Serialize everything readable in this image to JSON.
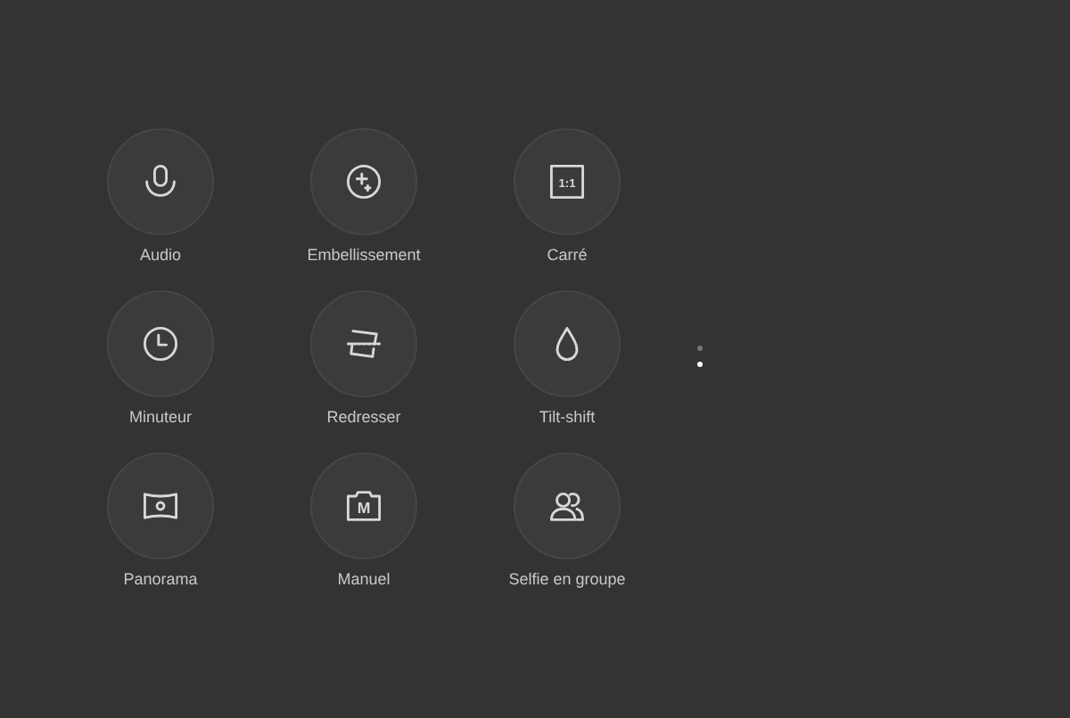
{
  "modes": [
    {
      "label": "Audio"
    },
    {
      "label": "Embellissement"
    },
    {
      "label": "Carré",
      "badge": "1:1"
    },
    {
      "label": "Minuteur"
    },
    {
      "label": "Redresser"
    },
    {
      "label": "Tilt-shift"
    },
    {
      "label": "Panorama"
    },
    {
      "label": "Manuel",
      "badge": "M"
    },
    {
      "label": "Selfie en groupe"
    }
  ],
  "pages": [
    {
      "selected": false
    },
    {
      "selected": true
    }
  ]
}
